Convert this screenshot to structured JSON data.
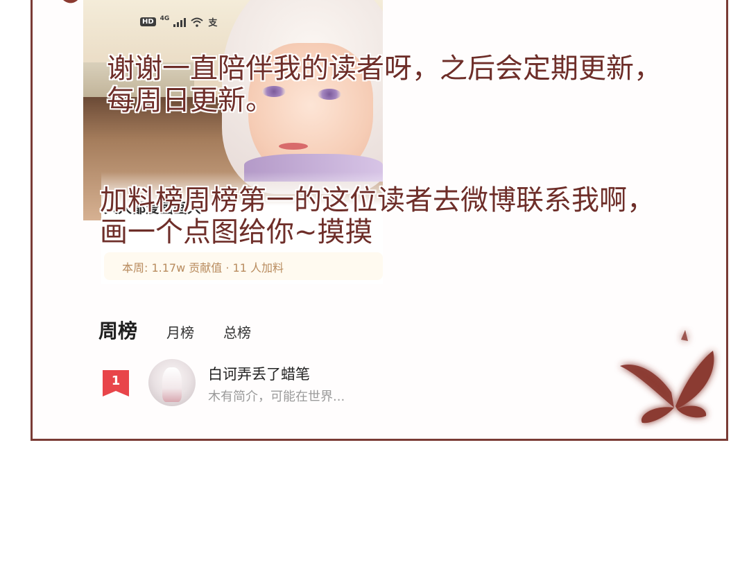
{
  "status_bar": {
    "hd": "HD",
    "network": "4G",
    "extra_icon": "支"
  },
  "card": {
    "title_partial": "人人都爱画画人",
    "stats": "本周: 1.17w 贡献值 · 11 人加料"
  },
  "captions": {
    "line1": "谢谢一直陪伴我的读者呀，之后会定期更新，",
    "line2": "每周日更新。",
    "line3": "加料榜周榜第一的这位读者去微博联系我啊，",
    "line4": "画一个点图给你~摸摸"
  },
  "tabs": [
    {
      "label": "周榜",
      "active": true
    },
    {
      "label": "月榜",
      "active": false
    },
    {
      "label": "总榜",
      "active": false
    }
  ],
  "ranking": [
    {
      "rank": "1",
      "name": "白诃弄丢了蜡笔",
      "bio": "木有简介，可能在世界..."
    }
  ],
  "colors": {
    "frame": "#7a3b35",
    "caption": "#6e2e29",
    "rank_badge": "#e8454a",
    "butterfly": "#8b3a31"
  }
}
